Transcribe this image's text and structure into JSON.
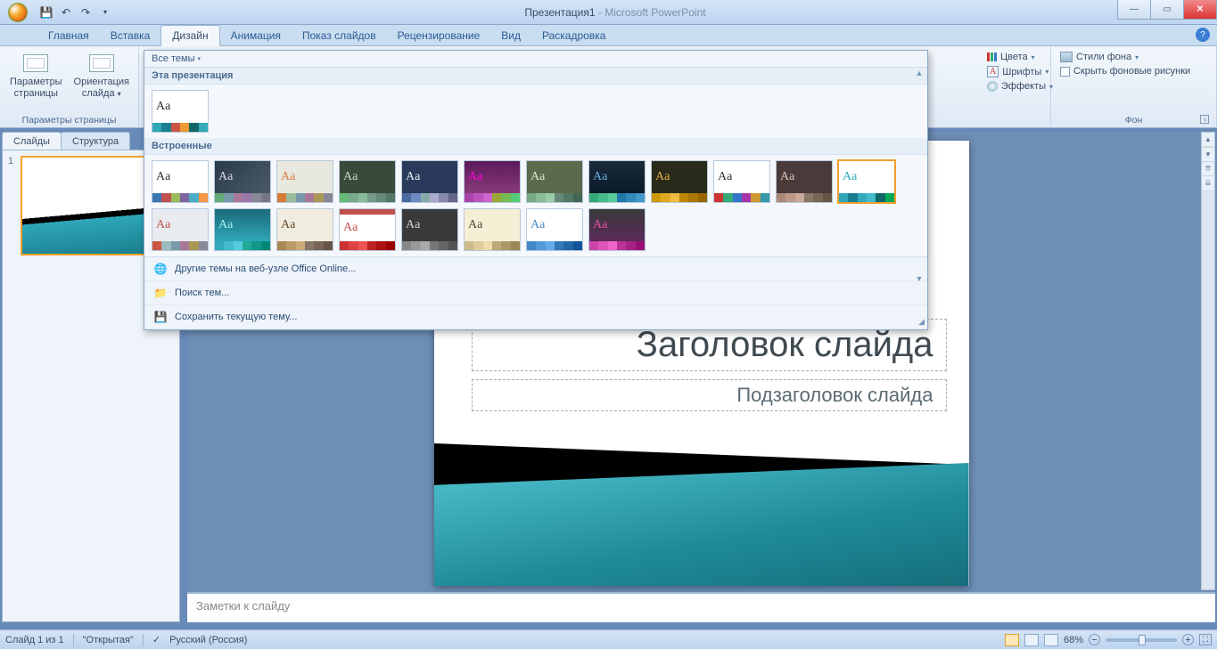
{
  "title": {
    "doc": "Презентация1",
    "app": "Microsoft PowerPoint"
  },
  "tabs": {
    "home": "Главная",
    "insert": "Вставка",
    "design": "Дизайн",
    "anim": "Анимация",
    "slideshow": "Показ слайдов",
    "review": "Рецензирование",
    "view": "Вид",
    "storyboard": "Раскадровка"
  },
  "ribbon": {
    "page_setup": {
      "btn1": "Параметры страницы",
      "btn2": "Ориентация слайда",
      "label": "Параметры страницы"
    },
    "themes_hdr": "Все темы",
    "sections": {
      "this": "Эта презентация",
      "builtin": "Встроенные"
    },
    "footer_items": {
      "online": "Другие темы на веб-узле Office Online...",
      "browse": "Поиск тем...",
      "save": "Сохранить текущую тему..."
    },
    "colors": "Цвета",
    "fonts": "Шрифты",
    "effects": "Эффекты",
    "bg_styles": "Стили фона",
    "hide_bg": "Скрыть фоновые рисунки",
    "bg_label": "Фон"
  },
  "side": {
    "slides": "Слайды",
    "outline": "Структура"
  },
  "slide": {
    "num": "1",
    "title": "Заголовок слайда",
    "subtitle": "Подзаголовок слайда"
  },
  "notes": {
    "placeholder": "Заметки к слайду"
  },
  "status": {
    "slide_of": "Слайд 1 из 1",
    "theme": "\"Открытая\"",
    "lang": "Русский (Россия)",
    "zoom": "68%"
  },
  "themes_row1": [
    {
      "bg": "#ffffff",
      "fg": "#333",
      "s": [
        "#3a76b1",
        "#c0504d",
        "#9bbb59",
        "#8064a2",
        "#4bacc6",
        "#f79646"
      ]
    },
    {
      "bg": "linear-gradient(135deg,#2b3a4a,#4a5a6a)",
      "fg": "#dde",
      "s": [
        "#6a7",
        "#79a",
        "#a79",
        "#97a",
        "#889",
        "#778"
      ]
    },
    {
      "bg": "#e8e8e0",
      "fg": "#d67a3a",
      "s": [
        "#d67a3a",
        "#9b9",
        "#79a",
        "#a79",
        "#a95",
        "#889"
      ]
    },
    {
      "bg": "#3a4a3a",
      "fg": "#cfd8cf",
      "s": [
        "#6b7",
        "#7a8",
        "#8b9",
        "#798",
        "#687",
        "#576"
      ]
    },
    {
      "bg": "#2a3a5a",
      "fg": "#e6edf5",
      "s": [
        "#4a6aa0",
        "#6a8ac0",
        "#8aa",
        "#aac",
        "#88a",
        "#668"
      ]
    },
    {
      "bg": "linear-gradient(#5a1a5a,#8a3a7a)",
      "fg": "#f0d",
      "s": [
        "#a4a",
        "#b5b",
        "#c6c",
        "#9a3",
        "#7b5",
        "#5c7"
      ]
    },
    {
      "bg": "#5a6a4a",
      "fg": "#e0e6d0",
      "s": [
        "#7a8",
        "#8b9",
        "#9ca",
        "#687",
        "#576",
        "#465"
      ]
    },
    {
      "bg": "linear-gradient(#1a2a3a,#0a1a2a)",
      "fg": "#6ab0e0",
      "s": [
        "#3a7",
        "#4b8",
        "#5c9",
        "#27a",
        "#38b",
        "#49c"
      ]
    },
    {
      "bg": "#2a2a1a",
      "fg": "#e0b040",
      "s": [
        "#c90",
        "#da2",
        "#eb4",
        "#b80",
        "#a70",
        "#960"
      ]
    },
    {
      "bg": "#ffffff",
      "fg": "#333",
      "s": [
        "#c33",
        "#3a7",
        "#37c",
        "#a3a",
        "#c93",
        "#39a"
      ]
    },
    {
      "bg": "#4a3a3a",
      "fg": "#d8c8b8",
      "s": [
        "#a87",
        "#b98",
        "#ca9",
        "#876",
        "#765",
        "#654"
      ]
    },
    {
      "bg": "#ffffff",
      "fg": "#2ea7b8",
      "s": [
        "#2ea7b8",
        "#1a7e8e",
        "#3ab",
        "#4bc",
        "#166",
        "#0a5"
      ],
      "sel": true
    }
  ],
  "themes_row2": [
    {
      "bg": "#e8ecf0",
      "fg": "#c0504d",
      "s": [
        "#c54",
        "#9bb",
        "#79a",
        "#a79",
        "#a95",
        "#889"
      ]
    },
    {
      "bg": "linear-gradient(#1a6a7a,#2ea7b8)",
      "fg": "#aee",
      "s": [
        "#3ab",
        "#4bc",
        "#5cd",
        "#2a9",
        "#198",
        "#087"
      ]
    },
    {
      "bg": "#f0ece0",
      "fg": "#6a4a2a",
      "s": [
        "#a85",
        "#b96",
        "#ca7",
        "#876",
        "#765",
        "#654"
      ]
    },
    {
      "bg": "#ffffff",
      "fg": "#c0504d",
      "s": [
        "#c33",
        "#d44",
        "#e55",
        "#b22",
        "#a11",
        "#900"
      ],
      "top": "#c0504d"
    },
    {
      "bg": "#3a3a3a",
      "fg": "#d0d0d0",
      "s": [
        "#888",
        "#999",
        "#aaa",
        "#777",
        "#666",
        "#555"
      ]
    },
    {
      "bg": "#f5efd5",
      "fg": "#4a4a3a",
      "s": [
        "#cb8",
        "#dc9",
        "#eda",
        "#ba7",
        "#a96",
        "#985"
      ]
    },
    {
      "bg": "#ffffff",
      "fg": "#4a8ac0",
      "s": [
        "#48c",
        "#59d",
        "#6ae",
        "#37b",
        "#26a",
        "#159"
      ]
    },
    {
      "bg": "linear-gradient(#3a3a3a,#5a2a5a)",
      "fg": "#e050a0",
      "s": [
        "#c4a",
        "#d5b",
        "#e6c",
        "#b39",
        "#a28",
        "#917"
      ]
    }
  ]
}
